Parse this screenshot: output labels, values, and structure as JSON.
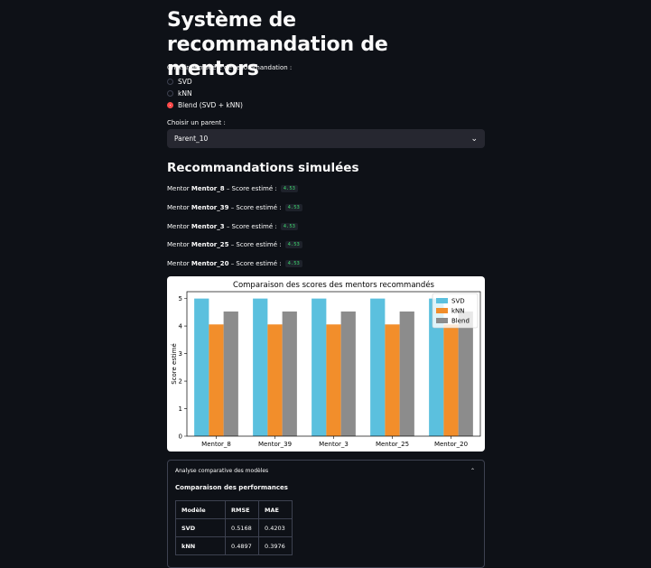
{
  "title": "Système de recommandation de mentors",
  "model_select": {
    "label": "Choisir le modèle de recommandation :",
    "options": [
      "SVD",
      "kNN",
      "Blend (SVD + kNN)"
    ],
    "selected": "Blend (SVD + kNN)"
  },
  "parent_select": {
    "label": "Choisir un parent :",
    "value": "Parent_10"
  },
  "recommendations": {
    "heading": "Recommandations simulées",
    "prefix": "Mentor ",
    "suffix": " – Score estimé :",
    "items": [
      {
        "mentor": "Mentor_8",
        "score": "4.53"
      },
      {
        "mentor": "Mentor_39",
        "score": "4.53"
      },
      {
        "mentor": "Mentor_3",
        "score": "4.53"
      },
      {
        "mentor": "Mentor_25",
        "score": "4.53"
      },
      {
        "mentor": "Mentor_20",
        "score": "4.53"
      }
    ]
  },
  "chart_data": {
    "type": "bar",
    "title": "Comparaison des scores des mentors recommandés",
    "xlabel": "",
    "ylabel": "Score estimé",
    "ylim": [
      0,
      5.25
    ],
    "yticks": [
      0,
      1,
      2,
      3,
      4,
      5
    ],
    "categories": [
      "Mentor_8",
      "Mentor_39",
      "Mentor_3",
      "Mentor_25",
      "Mentor_20"
    ],
    "series": [
      {
        "name": "SVD",
        "color": "#5bc0de",
        "values": [
          5.0,
          5.0,
          5.0,
          5.0,
          5.0
        ]
      },
      {
        "name": "kNN",
        "color": "#f28e2b",
        "values": [
          4.06,
          4.06,
          4.06,
          4.06,
          4.06
        ]
      },
      {
        "name": "Blend",
        "color": "#8c8c8c",
        "values": [
          4.53,
          4.53,
          4.53,
          4.53,
          4.53
        ]
      }
    ],
    "legend": "top-right",
    "grid": false
  },
  "analysis": {
    "expander_label": "Analyse comparative des modèles",
    "subheading": "Comparaison des performances",
    "columns": [
      "Modèle",
      "RMSE",
      "MAE"
    ],
    "rows": [
      [
        "SVD",
        "0.5168",
        "0.4203"
      ],
      [
        "kNN",
        "0.4897",
        "0.3976"
      ]
    ]
  }
}
